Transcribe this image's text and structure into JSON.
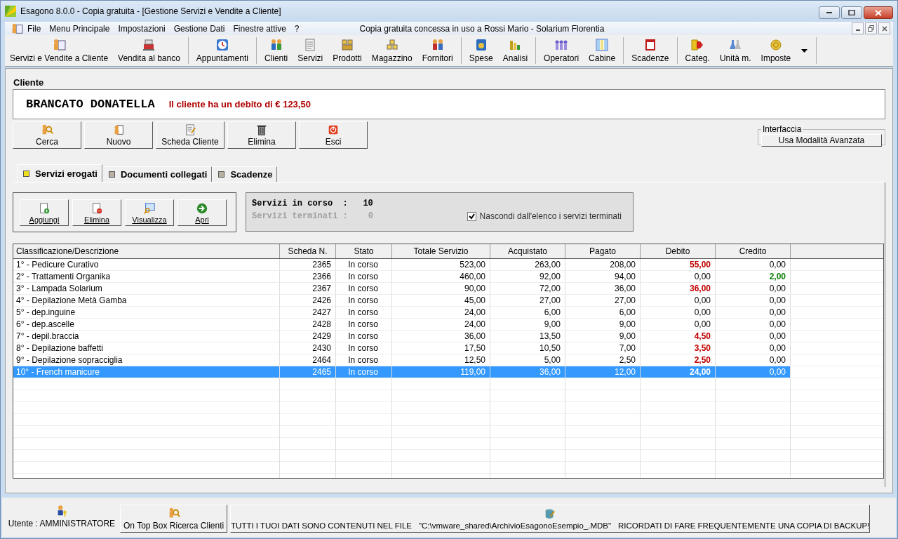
{
  "window": {
    "title": "Esagono 8.0.0 - Copia gratuita - [Gestione Servizi e Vendite a Cliente]"
  },
  "menu": {
    "items": [
      "File",
      "Menu Principale",
      "Impostazioni",
      "Gestione Dati",
      "Finestre attive",
      "?"
    ],
    "license": "Copia gratuita concessa in uso a Rossi Mario - Solarium Florentia"
  },
  "toolbar": [
    [
      "Servizi e Vendite a Cliente",
      "Vendita al banco"
    ],
    [
      "Appuntamenti"
    ],
    [
      "Clienti",
      "Servizi",
      "Prodotti",
      "Magazzino",
      "Fornitori"
    ],
    [
      "Spese",
      "Analisi"
    ],
    [
      "Operatori",
      "Cabine"
    ],
    [
      "Scadenze"
    ],
    [
      "Categ.",
      "Unità m.",
      "Imposte"
    ]
  ],
  "section_title": "Cliente",
  "client": {
    "name": "BRANCATO DONATELLA",
    "debt_notice": "Il cliente ha un debito di € 123,50"
  },
  "client_buttons": [
    "Cerca",
    "Nuovo",
    "Scheda Cliente",
    "Elimina",
    "Esci"
  ],
  "interface_group": {
    "title": "Interfaccia",
    "button": "Usa Modalità Avanzata"
  },
  "tabs": [
    {
      "label": "Servizi erogati",
      "selected": true
    },
    {
      "label": "Documenti collegati",
      "selected": false
    },
    {
      "label": "Scadenze",
      "selected": false
    }
  ],
  "service_buttons": [
    "Aggiungi",
    "Elimina",
    "Visualizza",
    "Apri"
  ],
  "summary": {
    "in_progress_label": "Servizi in corso  :",
    "in_progress_value": "10",
    "finished_label": "Servizi terminati :",
    "finished_value": "0",
    "hide_finished": {
      "label": "Nascondi dall'elenco i servizi terminati",
      "checked": true
    }
  },
  "table": {
    "columns": [
      "Classificazione/Descrizione",
      "Scheda N.",
      "Stato",
      "Totale Servizio",
      "Acquistato",
      "Pagato",
      "Debito",
      "Credito"
    ],
    "rows": [
      {
        "description": "1° - Pedicure Curativo",
        "scheda": "2365",
        "stato": "In corso",
        "totale": "523,00",
        "acquistato": "263,00",
        "pagato": "208,00",
        "debito": {
          "value": "55,00",
          "alert": true
        },
        "credito": {
          "value": "0,00",
          "alert": false
        },
        "selected": false
      },
      {
        "description": "2° - Trattamenti Organika",
        "scheda": "2366",
        "stato": "In corso",
        "totale": "460,00",
        "acquistato": "92,00",
        "pagato": "94,00",
        "debito": {
          "value": "0,00",
          "alert": false
        },
        "credito": {
          "value": "2,00",
          "alert": true
        },
        "selected": false
      },
      {
        "description": "3° - Lampada Solarium",
        "scheda": "2367",
        "stato": "In corso",
        "totale": "90,00",
        "acquistato": "72,00",
        "pagato": "36,00",
        "debito": {
          "value": "36,00",
          "alert": true
        },
        "credito": {
          "value": "0,00",
          "alert": false
        },
        "selected": false
      },
      {
        "description": "4° - Depilazione Metà Gamba",
        "scheda": "2426",
        "stato": "In corso",
        "totale": "45,00",
        "acquistato": "27,00",
        "pagato": "27,00",
        "debito": {
          "value": "0,00",
          "alert": false
        },
        "credito": {
          "value": "0,00",
          "alert": false
        },
        "selected": false
      },
      {
        "description": "5° - dep.inguine",
        "scheda": "2427",
        "stato": "In corso",
        "totale": "24,00",
        "acquistato": "6,00",
        "pagato": "6,00",
        "debito": {
          "value": "0,00",
          "alert": false
        },
        "credito": {
          "value": "0,00",
          "alert": false
        },
        "selected": false
      },
      {
        "description": "6° - dep.ascelle",
        "scheda": "2428",
        "stato": "In corso",
        "totale": "24,00",
        "acquistato": "9,00",
        "pagato": "9,00",
        "debito": {
          "value": "0,00",
          "alert": false
        },
        "credito": {
          "value": "0,00",
          "alert": false
        },
        "selected": false
      },
      {
        "description": "7° - depil.braccia",
        "scheda": "2429",
        "stato": "In corso",
        "totale": "36,00",
        "acquistato": "13,50",
        "pagato": "9,00",
        "debito": {
          "value": "4,50",
          "alert": true
        },
        "credito": {
          "value": "0,00",
          "alert": false
        },
        "selected": false
      },
      {
        "description": "8° - Depilazione baffetti",
        "scheda": "2430",
        "stato": "In corso",
        "totale": "17,50",
        "acquistato": "10,50",
        "pagato": "7,00",
        "debito": {
          "value": "3,50",
          "alert": true
        },
        "credito": {
          "value": "0,00",
          "alert": false
        },
        "selected": false
      },
      {
        "description": "9° - Depilazione sopracciglia",
        "scheda": "2464",
        "stato": "In corso",
        "totale": "12,50",
        "acquistato": "5,00",
        "pagato": "2,50",
        "debito": {
          "value": "2,50",
          "alert": true
        },
        "credito": {
          "value": "0,00",
          "alert": false
        },
        "selected": false
      },
      {
        "description": "10° - French manicure",
        "scheda": "2465",
        "stato": "In corso",
        "totale": "119,00",
        "acquistato": "36,00",
        "pagato": "12,00",
        "debito": {
          "value": "24,00",
          "alert": true
        },
        "credito": {
          "value": "0,00",
          "alert": false
        },
        "selected": true
      }
    ]
  },
  "status_bar": {
    "user": "Utente : AMMINISTRATORE",
    "search_button": "On Top Box Ricerca Clienti",
    "notice_parts": [
      "TUTTI I TUOI DATI SONO CONTENUTI NEL FILE",
      "\"C:\\vmware_shared\\ArchivioEsagonoEsempio_.MDB\"",
      "RICORDATI DI FARE FREQUENTEMENTE UNA COPIA DI BACKUP!"
    ]
  }
}
